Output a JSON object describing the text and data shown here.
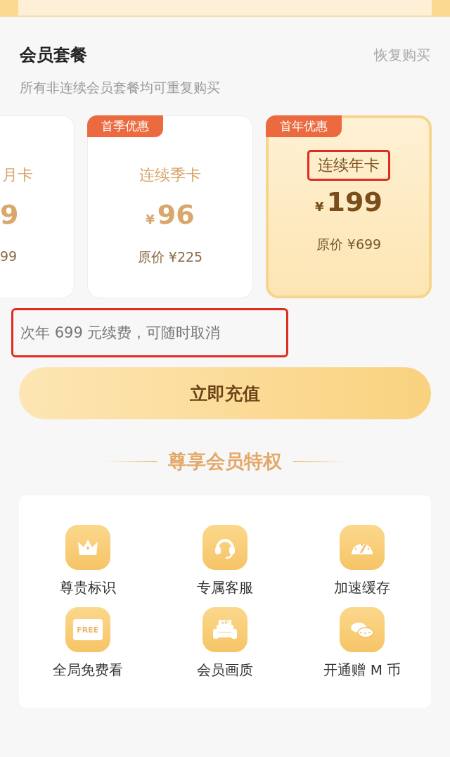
{
  "section": {
    "title": "会员套餐",
    "restore_link": "恢复购买",
    "subtitle": "所有非连续会员套餐均可重复购买"
  },
  "plans": [
    {
      "kind": "partial",
      "name": "月卡",
      "price": "9",
      "original": "99",
      "selected": false
    },
    {
      "kind": "full",
      "tag": "首季优惠",
      "name": "连续季卡",
      "currency": "¥",
      "price": "96",
      "original": "原价 ¥225",
      "selected": false
    },
    {
      "kind": "full",
      "tag": "首年优惠",
      "name": "连续年卡",
      "currency": "¥",
      "price": "199",
      "original": "原价 ¥699",
      "selected": true,
      "highlighted": true
    }
  ],
  "renewal_note": {
    "text": "次年 699 元续费，可随时取消",
    "highlighted": true
  },
  "pay_button": "立即充值",
  "perks_title": "尊享会员特权",
  "perks": [
    {
      "kind": "crown",
      "label": "尊贵标识"
    },
    {
      "kind": "headset",
      "label": "专属客服"
    },
    {
      "kind": "gauge",
      "label": "加速缓存"
    },
    {
      "kind": "free",
      "label": "全局免费看",
      "icon_text": "FREE"
    },
    {
      "kind": "sofa",
      "label": "会员画质",
      "icon_text": "VIP"
    },
    {
      "kind": "coins",
      "label": "开通赠 M 币"
    }
  ]
}
